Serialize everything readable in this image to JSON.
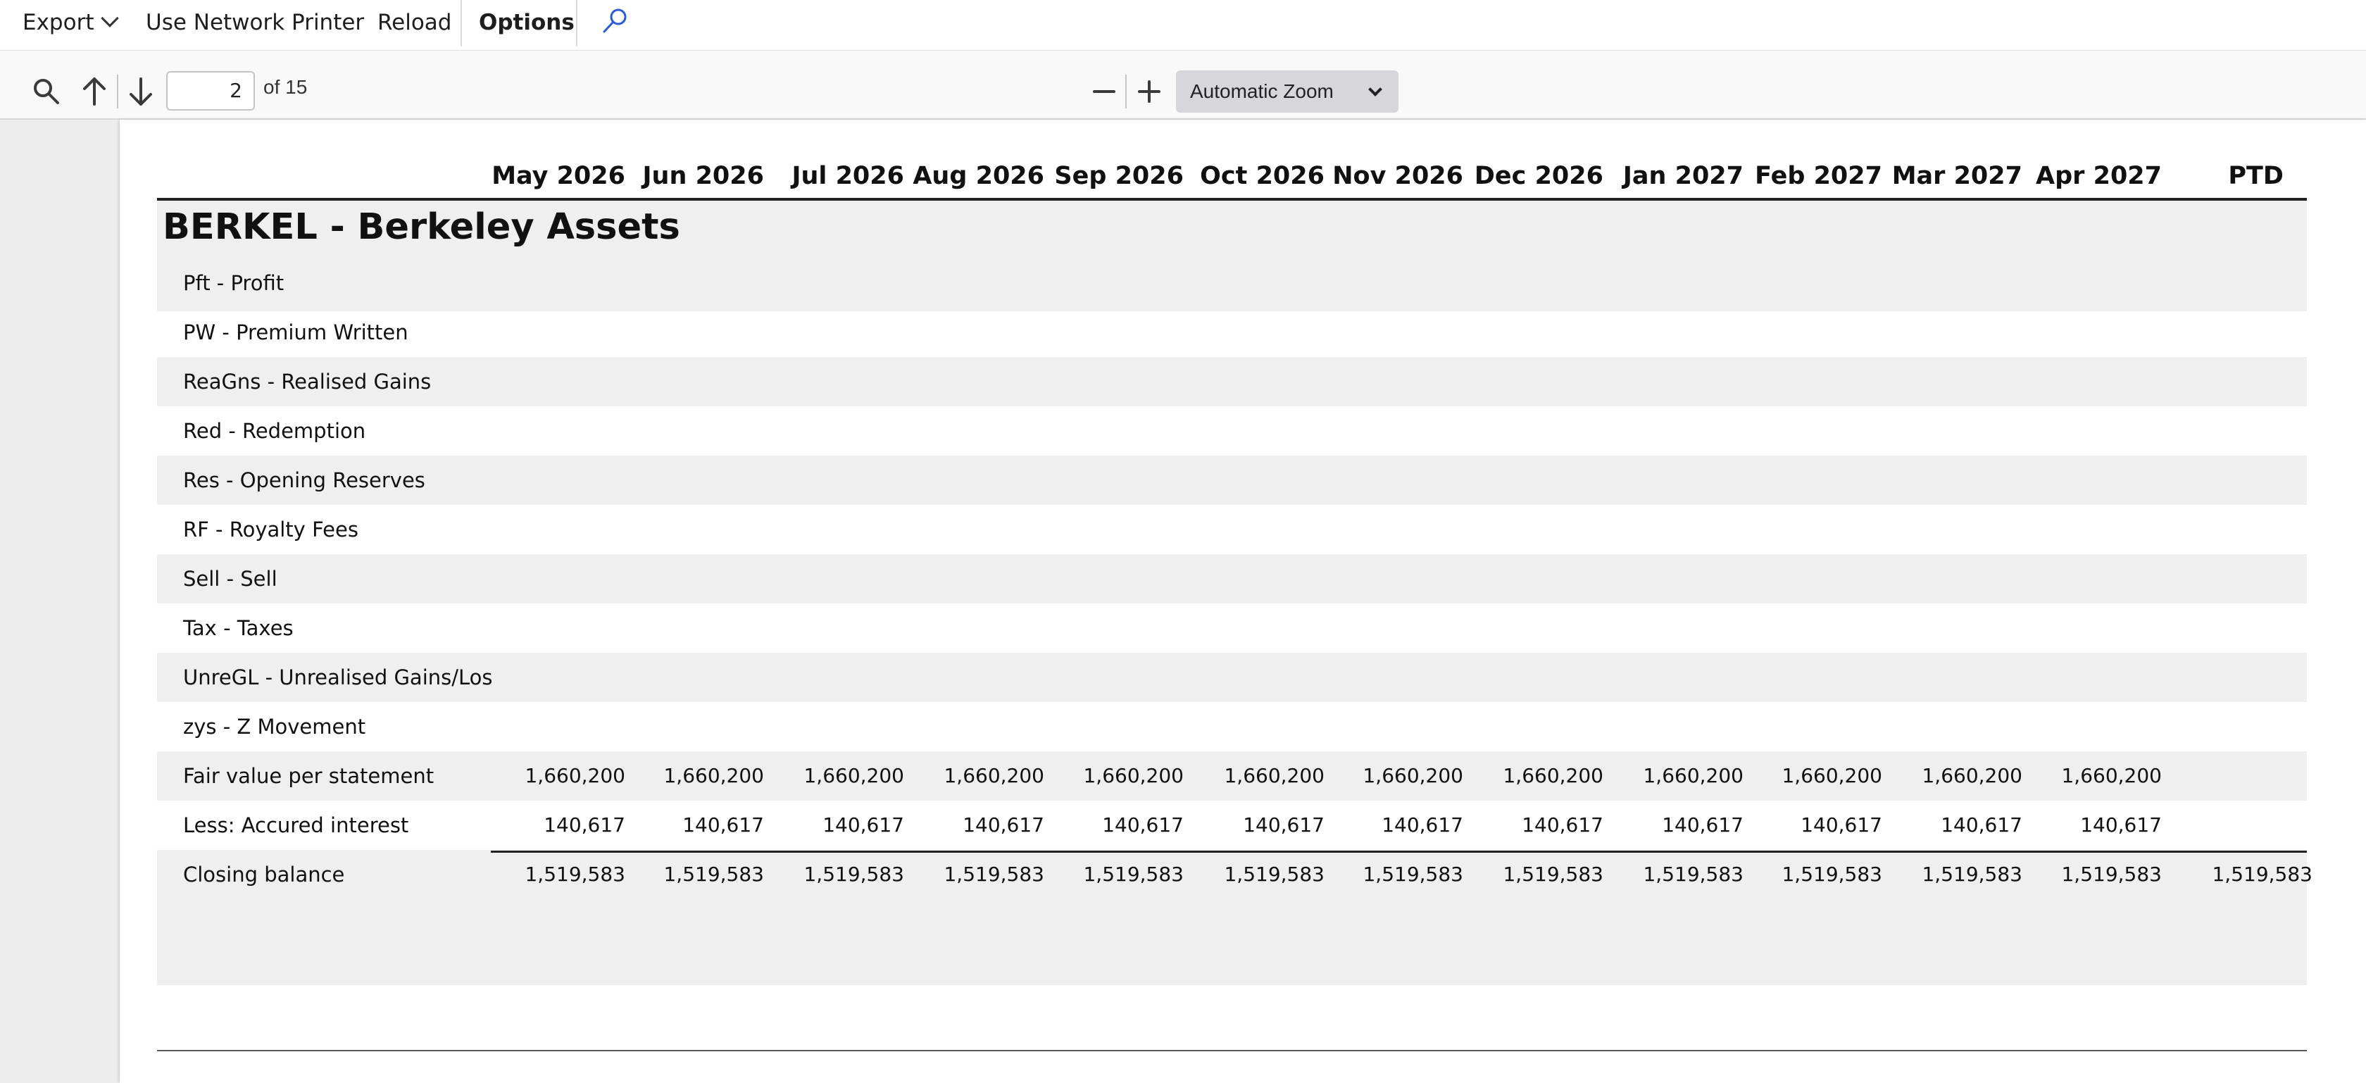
{
  "menu": {
    "export_label": "Export",
    "network_printer_label": "Use Network Printer",
    "reload_label": "Reload",
    "options_label": "Options"
  },
  "toolbar": {
    "page_number": "2",
    "page_total_label": "of 15",
    "zoom_label": "Automatic Zoom"
  },
  "report": {
    "columns": [
      "May 2026",
      "Jun 2026",
      "Jul 2026",
      "Aug 2026",
      "Sep 2026",
      "Oct 2026",
      "Nov 2026",
      "Dec 2026",
      "Jan 2027",
      "Feb 2027",
      "Mar 2027",
      "Apr 2027",
      "PTD"
    ],
    "section_title": "BERKEL - Berkeley Assets",
    "rows": [
      {
        "label": "Pft - Profit",
        "values": [
          "",
          "",
          "",
          "",
          "",
          "",
          "",
          "",
          "",
          "",
          "",
          "",
          ""
        ]
      },
      {
        "label": "PW - Premium Written",
        "values": [
          "",
          "",
          "",
          "",
          "",
          "",
          "",
          "",
          "",
          "",
          "",
          "",
          ""
        ]
      },
      {
        "label": "ReaGns - Realised Gains",
        "values": [
          "",
          "",
          "",
          "",
          "",
          "",
          "",
          "",
          "",
          "",
          "",
          "",
          ""
        ]
      },
      {
        "label": "Red - Redemption",
        "values": [
          "",
          "",
          "",
          "",
          "",
          "",
          "",
          "",
          "",
          "",
          "",
          "",
          ""
        ]
      },
      {
        "label": "Res - Opening Reserves",
        "values": [
          "",
          "",
          "",
          "",
          "",
          "",
          "",
          "",
          "",
          "",
          "",
          "",
          ""
        ]
      },
      {
        "label": "RF - Royalty Fees",
        "values": [
          "",
          "",
          "",
          "",
          "",
          "",
          "",
          "",
          "",
          "",
          "",
          "",
          ""
        ]
      },
      {
        "label": "Sell - Sell",
        "values": [
          "",
          "",
          "",
          "",
          "",
          "",
          "",
          "",
          "",
          "",
          "",
          "",
          ""
        ]
      },
      {
        "label": "Tax - Taxes",
        "values": [
          "",
          "",
          "",
          "",
          "",
          "",
          "",
          "",
          "",
          "",
          "",
          "",
          ""
        ]
      },
      {
        "label": "UnreGL - Unrealised Gains/Los",
        "values": [
          "",
          "",
          "",
          "",
          "",
          "",
          "",
          "",
          "",
          "",
          "",
          "",
          ""
        ]
      },
      {
        "label": "zys - Z Movement",
        "values": [
          "",
          "",
          "",
          "",
          "",
          "",
          "",
          "",
          "",
          "",
          "",
          "",
          ""
        ]
      },
      {
        "label": "Fair value per statement",
        "values": [
          "1,660,200",
          "1,660,200",
          "1,660,200",
          "1,660,200",
          "1,660,200",
          "1,660,200",
          "1,660,200",
          "1,660,200",
          "1,660,200",
          "1,660,200",
          "1,660,200",
          "1,660,200",
          ""
        ]
      },
      {
        "label": "Less: Accured interest",
        "values": [
          "140,617",
          "140,617",
          "140,617",
          "140,617",
          "140,617",
          "140,617",
          "140,617",
          "140,617",
          "140,617",
          "140,617",
          "140,617",
          "140,617",
          ""
        ]
      },
      {
        "label": "Closing balance",
        "values": [
          "1,519,583",
          "1,519,583",
          "1,519,583",
          "1,519,583",
          "1,519,583",
          "1,519,583",
          "1,519,583",
          "1,519,583",
          "1,519,583",
          "1,519,583",
          "1,519,583",
          "1,519,583",
          "1,519,583"
        ]
      }
    ]
  },
  "colors": {
    "shade": "#efefef",
    "accent_icon": "#2a5bd7"
  }
}
